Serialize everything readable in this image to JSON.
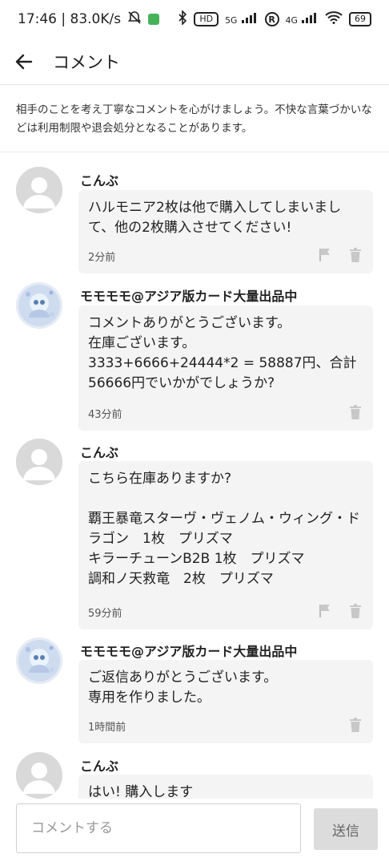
{
  "status_bar": {
    "time_speed": "17:46 | 83.0K/s",
    "hd": "HD",
    "net5g": "5G",
    "roaming": "R",
    "net4g": "4G",
    "battery": "69"
  },
  "header": {
    "title": "コメント"
  },
  "notice": {
    "text": "相手のことを考え丁寧なコメントを心がけましょう。不快な言葉づかいなどは利用制限や退会処分となることがあります。"
  },
  "comments": [
    {
      "author": "こんぶ",
      "body": "ハルモニア2枚は他で購入してしまいまして、他の2枚購入させてください!",
      "time": "2分前"
    },
    {
      "author": "モモモモ@アジア版カード大量出品中",
      "body": "コメントありがとうございます。\n在庫ございます。\n3333+6666+24444*2 = 58887円、合計56666円でいかがでしょうか?",
      "time": "43分前"
    },
    {
      "author": "こんぶ",
      "body": "こちら在庫ありますか?\n\n覇王暴竜スターヴ・ヴェノム・ウィング・ドラゴン　1枚　プリズマ\nキラーチューンB2B 1枚　プリズマ\n調和ノ天救竜　2枚　プリズマ",
      "time": "59分前"
    },
    {
      "author": "モモモモ@アジア版カード大量出品中",
      "body": "ご返信ありがとうございます。\n専用を作りました。",
      "time": "1時間前"
    },
    {
      "author": "こんぶ",
      "body": "はい! 購入します",
      "time": ""
    }
  ],
  "footer": {
    "placeholder": "コメントする",
    "send_label": "送信"
  }
}
